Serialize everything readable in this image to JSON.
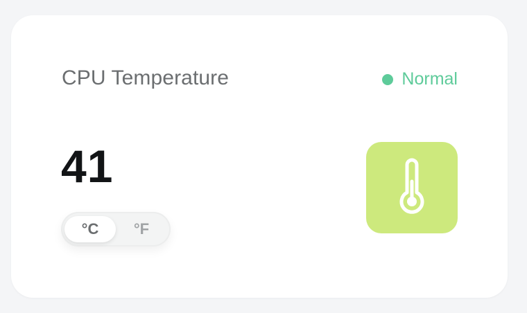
{
  "widget": {
    "title": "CPU Temperature",
    "status_label": "Normal",
    "status_color": "#5ecb9a",
    "value": "41",
    "units": [
      {
        "label": "°C",
        "active": true
      },
      {
        "label": "°F",
        "active": false
      }
    ],
    "icon": "thermometer-icon",
    "icon_tile_color": "#cde97d"
  }
}
